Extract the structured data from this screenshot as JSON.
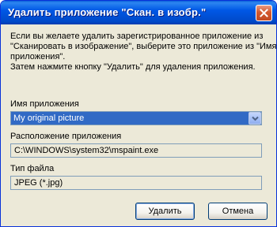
{
  "window": {
    "title": "Удалить приложение \"Скан. в изобр.\""
  },
  "description": {
    "lines": [
      "Если вы желаете удалить зарегистрированное приложение из",
      "\"Сканировать в изображение\", выберите это приложение из \"Имя",
      "приложения\".",
      "Затем нажмите кнопку \"Удалить\" для удаления приложения."
    ]
  },
  "app_name": {
    "label": "Имя приложения",
    "selected": "My original picture"
  },
  "location": {
    "label": "Расположение приложения",
    "value": "C:\\WINDOWS\\system32\\mspaint.exe"
  },
  "file_type": {
    "label": "Тип файла",
    "value": "JPEG (*.jpg)"
  },
  "buttons": {
    "delete_label": "Удалить",
    "cancel_label": "Отмена"
  },
  "colors": {
    "titlebar": "#0058E6",
    "selection": "#316AC5",
    "dialog_bg": "#ECE9D8",
    "close_button": "#D4582E"
  },
  "icons": {
    "close": "close-icon",
    "dropdown": "chevron-down-icon"
  }
}
